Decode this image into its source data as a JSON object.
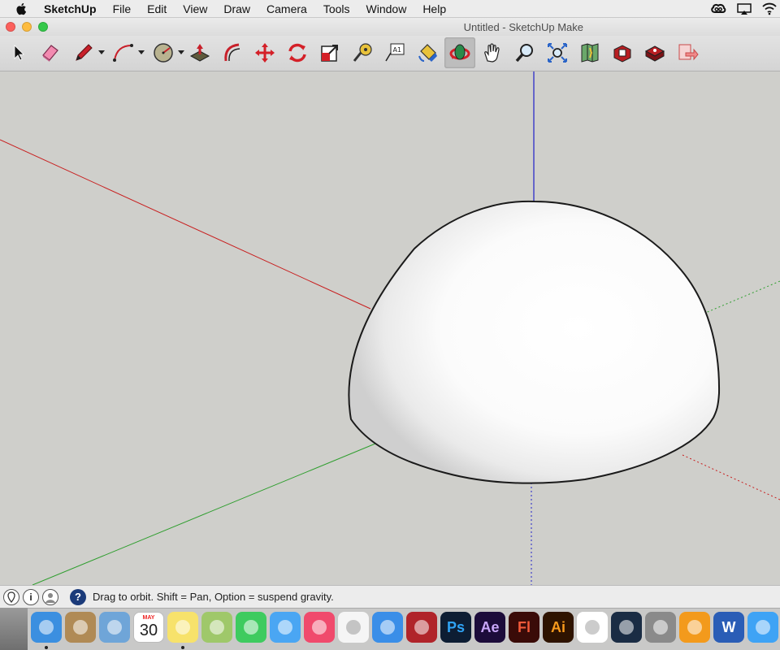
{
  "menubar": {
    "app_name": "SketchUp",
    "menus": [
      "File",
      "Edit",
      "View",
      "Draw",
      "Camera",
      "Tools",
      "Window",
      "Help"
    ],
    "status_icons": [
      "creative-cloud-icon",
      "airplay-icon",
      "wifi-icon"
    ]
  },
  "window": {
    "title": "Untitled - SketchUp Make"
  },
  "toolbar": {
    "tools": [
      {
        "name": "select-tool",
        "icon": "arrow-cursor-icon",
        "active": false
      },
      {
        "name": "eraser-tool",
        "icon": "eraser-icon",
        "active": false
      },
      {
        "name": "pencil-tool",
        "icon": "pencil-icon",
        "active": false,
        "dropdown": true
      },
      {
        "name": "arc-tool",
        "icon": "arc-icon",
        "active": false,
        "dropdown": true
      },
      {
        "name": "shape-tool",
        "icon": "circle-shape-icon",
        "active": false,
        "dropdown": true
      },
      {
        "name": "push-pull-tool",
        "icon": "push-pull-icon",
        "active": false
      },
      {
        "name": "offset-tool",
        "icon": "offset-icon",
        "active": false
      },
      {
        "name": "move-tool",
        "icon": "move-arrows-icon",
        "active": false
      },
      {
        "name": "rotate-tool",
        "icon": "rotate-icon",
        "active": false
      },
      {
        "name": "scale-tool",
        "icon": "scale-icon",
        "active": false
      },
      {
        "name": "tape-measure-tool",
        "icon": "tape-measure-icon",
        "active": false
      },
      {
        "name": "text-tool",
        "icon": "text-label-icon",
        "active": false
      },
      {
        "name": "paint-bucket-tool",
        "icon": "paint-bucket-icon",
        "active": false
      },
      {
        "name": "orbit-tool",
        "icon": "orbit-icon",
        "active": true
      },
      {
        "name": "pan-tool",
        "icon": "hand-icon",
        "active": false
      },
      {
        "name": "zoom-tool",
        "icon": "magnifier-icon",
        "active": false
      },
      {
        "name": "zoom-extents-tool",
        "icon": "zoom-extents-icon",
        "active": false
      },
      {
        "name": "add-location-tool",
        "icon": "map-location-icon",
        "active": false
      },
      {
        "name": "3d-warehouse-tool",
        "icon": "warehouse-icon",
        "active": false
      },
      {
        "name": "extension-warehouse-tool",
        "icon": "extension-warehouse-icon",
        "active": false
      },
      {
        "name": "send-to-layout-tool",
        "icon": "send-to-layout-icon",
        "active": false
      }
    ],
    "text_tool_glyph": "A1"
  },
  "statusbar": {
    "message": "Drag to orbit. Shift = Pan, Option = suspend gravity.",
    "info_glyph": "i",
    "help_glyph": "?"
  },
  "dock": {
    "calendar_month": "MAY",
    "calendar_day": "30",
    "apps": [
      {
        "name": "finder",
        "label": "",
        "color": "#3b8fe0",
        "running": true
      },
      {
        "name": "contacts",
        "label": "",
        "color": "#b08a55",
        "running": false
      },
      {
        "name": "preview",
        "label": "",
        "color": "#6fa5d8",
        "running": false
      },
      {
        "name": "calendar",
        "label": "",
        "color": "#ffffff",
        "running": false
      },
      {
        "name": "notes",
        "label": "",
        "color": "#f7e26b",
        "running": true
      },
      {
        "name": "iphoto",
        "label": "",
        "color": "#9fc86a",
        "running": false
      },
      {
        "name": "facetime",
        "label": "",
        "color": "#3ecb5f",
        "running": false
      },
      {
        "name": "messages",
        "label": "",
        "color": "#4aa6f3",
        "running": false
      },
      {
        "name": "itunes",
        "label": "",
        "color": "#f04a6c",
        "running": false
      },
      {
        "name": "reminders",
        "label": "",
        "color": "#f5f5f5",
        "running": false
      },
      {
        "name": "safari",
        "label": "",
        "color": "#3a8ee8",
        "running": false
      },
      {
        "name": "photo-booth",
        "label": "",
        "color": "#b0242a",
        "running": false
      },
      {
        "name": "photoshop",
        "label": "Ps",
        "color": "#0d1d33",
        "text_color": "#2fa3f5",
        "running": false
      },
      {
        "name": "after-effects",
        "label": "Ae",
        "color": "#1c0c3a",
        "text_color": "#c9a7f9",
        "running": false
      },
      {
        "name": "flash",
        "label": "Fl",
        "color": "#3a0b08",
        "text_color": "#f25a3a",
        "running": false
      },
      {
        "name": "illustrator",
        "label": "Ai",
        "color": "#2e1300",
        "text_color": "#f89a1c",
        "running": false
      },
      {
        "name": "photos",
        "label": "",
        "color": "#ffffff",
        "running": false
      },
      {
        "name": "steam",
        "label": "",
        "color": "#1a2c44",
        "running": false
      },
      {
        "name": "system-preferences",
        "label": "",
        "color": "#8a8a8a",
        "running": false
      },
      {
        "name": "ibooks",
        "label": "",
        "color": "#f39a1c",
        "running": false
      },
      {
        "name": "word",
        "label": "W",
        "color": "#2a5db6",
        "text_color": "#ffffff",
        "running": false
      },
      {
        "name": "app-store",
        "label": "",
        "color": "#3ea3f5",
        "running": false
      }
    ]
  },
  "scene": {
    "axis_colors": {
      "red": "#c81e1e",
      "green": "#2e9e2e",
      "blue": "#2020c8"
    },
    "object": "hemisphere"
  }
}
